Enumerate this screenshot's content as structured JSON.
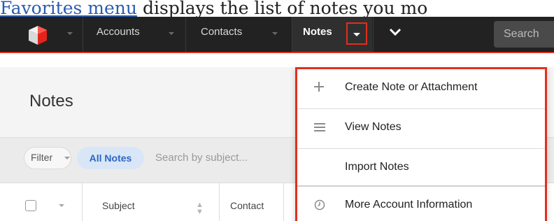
{
  "doc_text": {
    "link": "Favorites menu",
    "rest": " displays the list of notes you mo"
  },
  "navbar": {
    "items": [
      {
        "label": "Accounts"
      },
      {
        "label": "Contacts"
      },
      {
        "label": "Notes"
      }
    ],
    "search_placeholder": "Search"
  },
  "page": {
    "title": "Notes"
  },
  "filter": {
    "label": "Filter",
    "selected": "All Notes",
    "search_placeholder": "Search by subject..."
  },
  "table": {
    "columns": [
      "Subject",
      "Contact"
    ]
  },
  "menu": {
    "items": [
      {
        "label": "Create Note or Attachment",
        "icon": "plus-icon"
      },
      {
        "label": "View Notes",
        "icon": "list-icon"
      },
      {
        "label": "Import Notes",
        "icon": ""
      },
      {
        "label": "More Account Information",
        "icon": "clock-icon"
      }
    ]
  },
  "colors": {
    "navbar": "#222222",
    "highlight": "#e12f1c",
    "filter_pill": "#d9e6f7",
    "filter_text": "#2a66c4"
  }
}
